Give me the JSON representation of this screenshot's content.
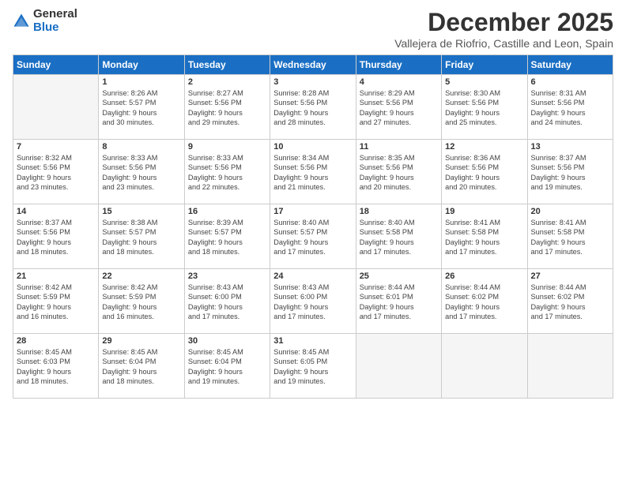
{
  "header": {
    "logo_general": "General",
    "logo_blue": "Blue",
    "month_title": "December 2025",
    "location": "Vallejera de Riofrio, Castille and Leon, Spain"
  },
  "weekdays": [
    "Sunday",
    "Monday",
    "Tuesday",
    "Wednesday",
    "Thursday",
    "Friday",
    "Saturday"
  ],
  "weeks": [
    [
      {
        "day": "",
        "info": ""
      },
      {
        "day": "1",
        "info": "Sunrise: 8:26 AM\nSunset: 5:57 PM\nDaylight: 9 hours\nand 30 minutes."
      },
      {
        "day": "2",
        "info": "Sunrise: 8:27 AM\nSunset: 5:56 PM\nDaylight: 9 hours\nand 29 minutes."
      },
      {
        "day": "3",
        "info": "Sunrise: 8:28 AM\nSunset: 5:56 PM\nDaylight: 9 hours\nand 28 minutes."
      },
      {
        "day": "4",
        "info": "Sunrise: 8:29 AM\nSunset: 5:56 PM\nDaylight: 9 hours\nand 27 minutes."
      },
      {
        "day": "5",
        "info": "Sunrise: 8:30 AM\nSunset: 5:56 PM\nDaylight: 9 hours\nand 25 minutes."
      },
      {
        "day": "6",
        "info": "Sunrise: 8:31 AM\nSunset: 5:56 PM\nDaylight: 9 hours\nand 24 minutes."
      }
    ],
    [
      {
        "day": "7",
        "info": "Sunrise: 8:32 AM\nSunset: 5:56 PM\nDaylight: 9 hours\nand 23 minutes."
      },
      {
        "day": "8",
        "info": "Sunrise: 8:33 AM\nSunset: 5:56 PM\nDaylight: 9 hours\nand 23 minutes."
      },
      {
        "day": "9",
        "info": "Sunrise: 8:33 AM\nSunset: 5:56 PM\nDaylight: 9 hours\nand 22 minutes."
      },
      {
        "day": "10",
        "info": "Sunrise: 8:34 AM\nSunset: 5:56 PM\nDaylight: 9 hours\nand 21 minutes."
      },
      {
        "day": "11",
        "info": "Sunrise: 8:35 AM\nSunset: 5:56 PM\nDaylight: 9 hours\nand 20 minutes."
      },
      {
        "day": "12",
        "info": "Sunrise: 8:36 AM\nSunset: 5:56 PM\nDaylight: 9 hours\nand 20 minutes."
      },
      {
        "day": "13",
        "info": "Sunrise: 8:37 AM\nSunset: 5:56 PM\nDaylight: 9 hours\nand 19 minutes."
      }
    ],
    [
      {
        "day": "14",
        "info": "Sunrise: 8:37 AM\nSunset: 5:56 PM\nDaylight: 9 hours\nand 18 minutes."
      },
      {
        "day": "15",
        "info": "Sunrise: 8:38 AM\nSunset: 5:57 PM\nDaylight: 9 hours\nand 18 minutes."
      },
      {
        "day": "16",
        "info": "Sunrise: 8:39 AM\nSunset: 5:57 PM\nDaylight: 9 hours\nand 18 minutes."
      },
      {
        "day": "17",
        "info": "Sunrise: 8:40 AM\nSunset: 5:57 PM\nDaylight: 9 hours\nand 17 minutes."
      },
      {
        "day": "18",
        "info": "Sunrise: 8:40 AM\nSunset: 5:58 PM\nDaylight: 9 hours\nand 17 minutes."
      },
      {
        "day": "19",
        "info": "Sunrise: 8:41 AM\nSunset: 5:58 PM\nDaylight: 9 hours\nand 17 minutes."
      },
      {
        "day": "20",
        "info": "Sunrise: 8:41 AM\nSunset: 5:58 PM\nDaylight: 9 hours\nand 17 minutes."
      }
    ],
    [
      {
        "day": "21",
        "info": "Sunrise: 8:42 AM\nSunset: 5:59 PM\nDaylight: 9 hours\nand 16 minutes."
      },
      {
        "day": "22",
        "info": "Sunrise: 8:42 AM\nSunset: 5:59 PM\nDaylight: 9 hours\nand 16 minutes."
      },
      {
        "day": "23",
        "info": "Sunrise: 8:43 AM\nSunset: 6:00 PM\nDaylight: 9 hours\nand 17 minutes."
      },
      {
        "day": "24",
        "info": "Sunrise: 8:43 AM\nSunset: 6:00 PM\nDaylight: 9 hours\nand 17 minutes."
      },
      {
        "day": "25",
        "info": "Sunrise: 8:44 AM\nSunset: 6:01 PM\nDaylight: 9 hours\nand 17 minutes."
      },
      {
        "day": "26",
        "info": "Sunrise: 8:44 AM\nSunset: 6:02 PM\nDaylight: 9 hours\nand 17 minutes."
      },
      {
        "day": "27",
        "info": "Sunrise: 8:44 AM\nSunset: 6:02 PM\nDaylight: 9 hours\nand 17 minutes."
      }
    ],
    [
      {
        "day": "28",
        "info": "Sunrise: 8:45 AM\nSunset: 6:03 PM\nDaylight: 9 hours\nand 18 minutes."
      },
      {
        "day": "29",
        "info": "Sunrise: 8:45 AM\nSunset: 6:04 PM\nDaylight: 9 hours\nand 18 minutes."
      },
      {
        "day": "30",
        "info": "Sunrise: 8:45 AM\nSunset: 6:04 PM\nDaylight: 9 hours\nand 19 minutes."
      },
      {
        "day": "31",
        "info": "Sunrise: 8:45 AM\nSunset: 6:05 PM\nDaylight: 9 hours\nand 19 minutes."
      },
      {
        "day": "",
        "info": ""
      },
      {
        "day": "",
        "info": ""
      },
      {
        "day": "",
        "info": ""
      }
    ]
  ]
}
